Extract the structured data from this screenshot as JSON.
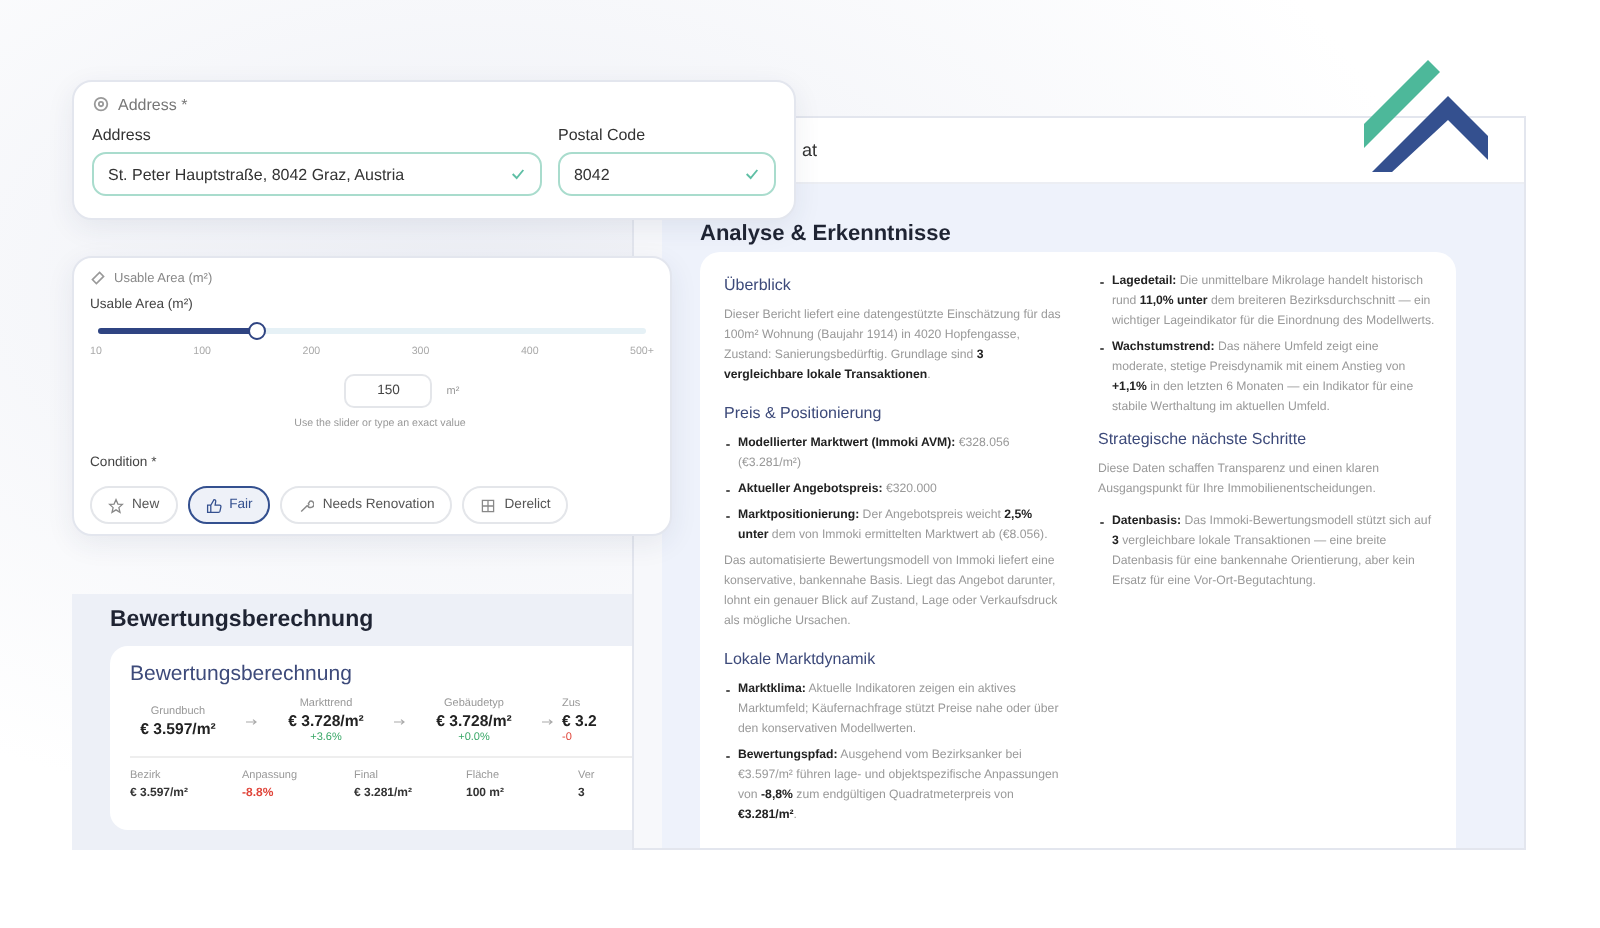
{
  "address_card": {
    "section_title": "Address *",
    "fields": [
      {
        "label": "Address",
        "value": "St. Peter Hauptstraße, 8042 Graz, Austria",
        "valid": true
      },
      {
        "label": "Postal Code",
        "value": "8042",
        "valid": true
      }
    ]
  },
  "area_card": {
    "section_title": "Usable Area (m²)",
    "slider": {
      "label": "Usable Area (m²)",
      "level": 0.29,
      "ticks": [
        "10",
        "100",
        "200",
        "300",
        "400",
        "500+"
      ]
    },
    "value": "150",
    "unit": "m²",
    "hint": "Use the slider or type an exact value",
    "condition": {
      "label": "Condition *",
      "options": [
        {
          "label": "New",
          "selected": false
        },
        {
          "label": "Fair",
          "selected": true
        },
        {
          "label": "Needs Renovation",
          "selected": false
        },
        {
          "label": "Derelict",
          "selected": false
        }
      ]
    }
  },
  "calculation": {
    "title": "Bewertungsberechnung",
    "card_title": "Bewertungsberechnung",
    "steps": [
      {
        "label": "Grundbuch",
        "value": "€ 3.597/m²"
      },
      {
        "label": "Markttrend",
        "value": "€ 3.728/m²",
        "change": "+3.6%",
        "negative": false
      },
      {
        "label": "Gebäudetyp",
        "value": "€ 3.728/m²",
        "change": "+0.0%",
        "negative": false
      },
      {
        "label": "Zus",
        "value": "€ 3.2",
        "change": "-0",
        "negative": true
      }
    ],
    "summary": [
      {
        "label": "Bezirk",
        "value": "€ 3.597/m²",
        "negative": false
      },
      {
        "label": "Anpassung",
        "value": "-8.8%",
        "negative": true
      },
      {
        "label": "Final",
        "value": "€ 3.281/m²",
        "negative": false
      },
      {
        "label": "Fläche",
        "value": "100 m²",
        "negative": false
      },
      {
        "label": "Ver",
        "value": "3",
        "negative": false
      }
    ]
  },
  "report": {
    "header_title": "at",
    "heading": "Analyse & Erkenntnisse",
    "columns": [
      [
        {
          "kind": "heading",
          "text": "Überblick"
        },
        {
          "kind": "paragraph",
          "text": "Dieser Bericht liefert eine datengestützte Einschätzung für das 100m² Wohnung (Baujahr 1914) in 4020 Hopfengasse, Zustand: Sanierungsbedürftig. Grundlage sind **3 vergleichbare lokale Transaktionen**."
        },
        {
          "kind": "heading",
          "text": "Preis & Positionierung"
        },
        {
          "kind": "bullet",
          "text": "**Modellierter Marktwert (Immoki AVM):** €328.056 (€3.281/m²)"
        },
        {
          "kind": "bullet",
          "text": "**Aktueller Angebotspreis:** €320.000"
        },
        {
          "kind": "bullet",
          "text": "**Marktpositionierung:** Der Angebotspreis weicht **2,5% unter** dem von Immoki ermittelten Marktwert ab (€8.056)."
        },
        {
          "kind": "paragraph",
          "text": "Das automatisierte Bewertungsmodell von Immoki liefert eine konservative, bankennahe Basis. Liegt das Angebot darunter, lohnt ein genauer Blick auf Zustand, Lage oder Verkaufsdruck als mögliche Ursachen."
        },
        {
          "kind": "heading",
          "text": "Lokale Marktdynamik"
        },
        {
          "kind": "bullet",
          "text": "**Marktklima:** Aktuelle Indikatoren zeigen ein aktives Marktumfeld; Käufernachfrage stützt Preise nahe oder über den konservativen Modellwerten."
        },
        {
          "kind": "bullet",
          "text": "**Bewertungspfad:** Ausgehend vom Bezirksanker bei €3.597/m² führen lage- und objektspezifische Anpassungen von **-8,8%** zum endgültigen Quadratmeterpreis von **€3.281/m²**."
        }
      ],
      [
        {
          "kind": "bullet",
          "text": "**Lagedetail:** Die unmittelbare Mikrolage handelt historisch rund **11,0% unter** dem breiteren Bezirksdurchschnitt — ein wichtiger Lageindikator für die Einordnung des Modellwerts."
        },
        {
          "kind": "bullet",
          "text": "**Wachstumstrend:** Das nähere Umfeld zeigt eine moderate, stetige Preisdynamik mit einem Anstieg von **+1,1%** in den letzten 6 Monaten — ein Indikator für eine stabile Werthaltung im aktuellen Umfeld."
        },
        {
          "kind": "heading",
          "text": "Strategische nächste Schritte"
        },
        {
          "kind": "paragraph",
          "text": "Diese Daten schaffen Transparenz und einen klaren Ausgangspunkt für Ihre Immobilienentscheidungen."
        },
        {
          "kind": "bullet",
          "text": "**Datenbasis:** Das Immoki-Bewertungsmodell stützt sich auf **3** vergleichbare lokale Transaktionen — eine breite Datenbasis für eine bankennahe Orientierung, aber kein Ersatz für eine Vor-Ort-Begutachtung."
        }
      ]
    ]
  }
}
